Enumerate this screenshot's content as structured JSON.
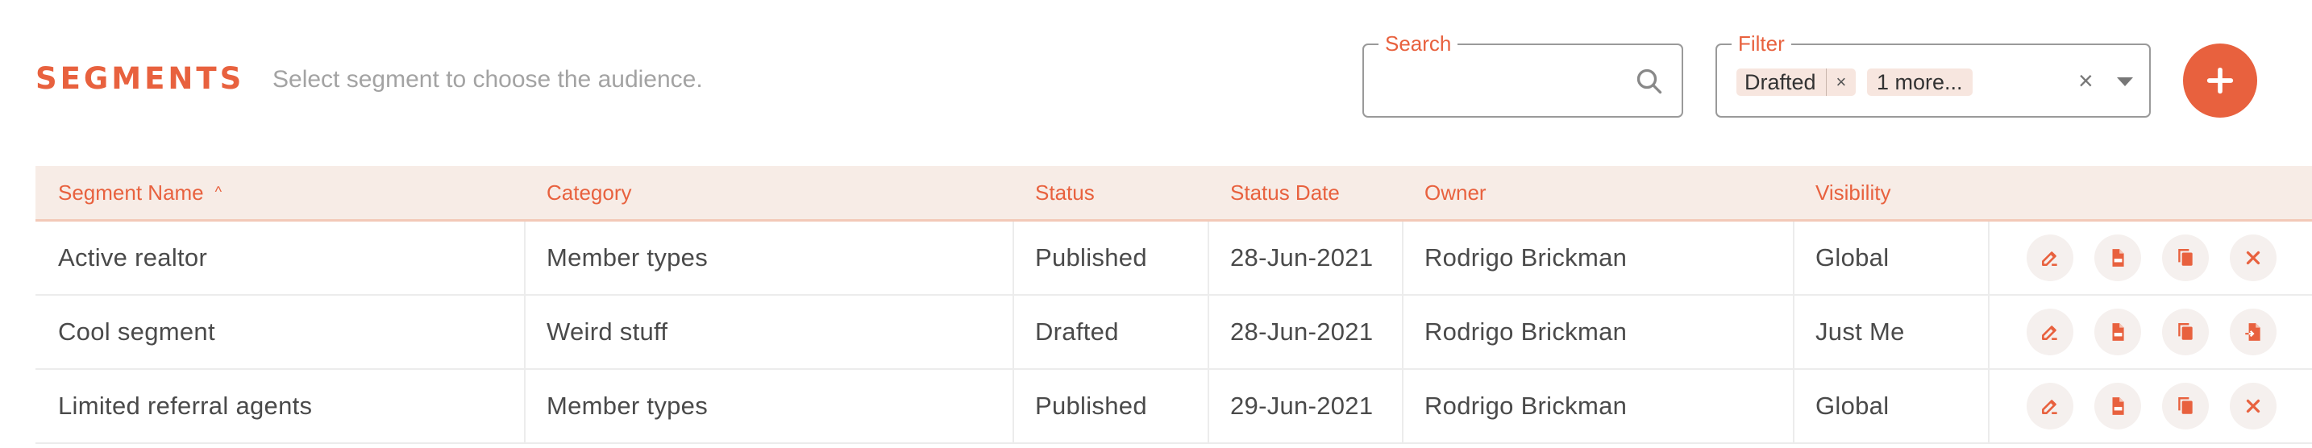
{
  "header": {
    "title": "SEGMENTS",
    "subtitle": "Select segment to choose the audience."
  },
  "search": {
    "label": "Search",
    "value": "",
    "icon": "search-icon"
  },
  "filter": {
    "label": "Filter",
    "chips": [
      "Drafted",
      "1 more..."
    ],
    "chip_remove": "×",
    "clear": "×"
  },
  "add_button": {
    "icon": "plus-icon"
  },
  "colors": {
    "accent": "#e8613e",
    "header_bg": "#f7ece6",
    "chip_bg": "#f7e6df"
  },
  "table": {
    "columns": [
      "Segment Name",
      "Category",
      "Status",
      "Status Date",
      "Owner",
      "Visibility"
    ],
    "sort_indicator": "^",
    "rows": [
      {
        "name": "Active realtor",
        "category": "Member types",
        "status": "Published",
        "date": "28-Jun-2021",
        "owner": "Rodrigo Brickman",
        "visibility": "Global",
        "last_action": "delete-icon"
      },
      {
        "name": "Cool segment",
        "category": "Weird stuff",
        "status": "Drafted",
        "date": "28-Jun-2021",
        "owner": "Rodrigo Brickman",
        "visibility": "Just Me",
        "last_action": "file-export-icon"
      },
      {
        "name": "Limited referral agents",
        "category": "Member types",
        "status": "Published",
        "date": "29-Jun-2021",
        "owner": "Rodrigo Brickman",
        "visibility": "Global",
        "last_action": "delete-icon"
      }
    ],
    "row_actions": [
      "edit-icon",
      "csv-file-icon",
      "copy-icon"
    ]
  }
}
